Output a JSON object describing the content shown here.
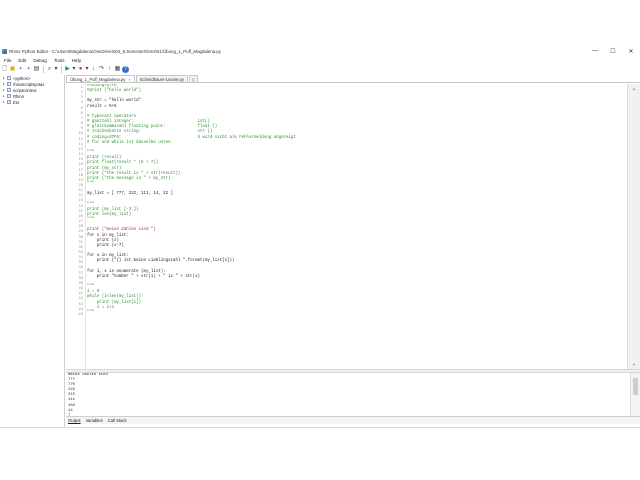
{
  "window": {
    "title": "Rhino Python Editor - C:\\Users\\Magdalena\\OneDrive\\003_5.Semester\\Dm2\\01\\Übung_1_Puff_Magdalena.py",
    "controls": [
      "—",
      "☐",
      "✕"
    ]
  },
  "menu": [
    "File",
    "Edit",
    "Debug",
    "Tools",
    "Help"
  ],
  "toolbar": {
    "icons": [
      "new-file-icon",
      "open-folder-icon",
      "save-icon",
      "save-all-icon",
      "print-icon",
      "find-icon",
      "dropdown-icon",
      "run-icon",
      "run-dropdown-icon",
      "stop-icon",
      "debug-dropdown-icon",
      "step-into-icon",
      "step-over-icon",
      "step-out-icon",
      "options-icon",
      "help-icon"
    ],
    "glyphs": {
      "new": "🗋",
      "open": "▣",
      "save": "▪",
      "save_all": "▪",
      "print": "▤",
      "find": "⌕",
      "find_dd": "▾",
      "run": "▶",
      "run_dd": "▾",
      "stop": "●",
      "stop_dd": "▾",
      "step_into": "↓",
      "step_over": "↷",
      "step_out": "↑",
      "options": "▦",
      "help": "?"
    }
  },
  "tree": [
    {
      "label": "<python>"
    },
    {
      "label": "rhinoscriptsyntax"
    },
    {
      "label": "scriptcontext"
    },
    {
      "label": "Rhino"
    },
    {
      "label": "Eto"
    }
  ],
  "tabs": [
    {
      "label": "Übung_1_Puff_Magdalena.py",
      "active": true,
      "close": "×"
    },
    {
      "label": "Schmidbauer-Leonie.py",
      "active": false,
      "close": ""
    }
  ],
  "new_tab_glyph": "▯",
  "code_lines": [
    {
      "n": "1",
      "t": "#coding=UTF8",
      "k": "c"
    },
    {
      "n": "2",
      "t": "#print (\"hello world\")",
      "k": "c"
    },
    {
      "n": "3",
      "t": "",
      "k": ""
    },
    {
      "n": "4",
      "t": "my_str = \"hello world\"",
      "k": ""
    },
    {
      "n": "5",
      "t": "result = 5+5",
      "k": ""
    },
    {
      "n": "6",
      "t": "",
      "k": ""
    },
    {
      "n": "7",
      "t": "# typecast operators",
      "k": "c"
    },
    {
      "n": "8",
      "t": "# ganzzahl integer:                          int()",
      "k": "c"
    },
    {
      "n": "9",
      "t": "# gleitkommazahl floating point:             float ()",
      "k": "c"
    },
    {
      "n": "10",
      "t": "# zeichenkette string:                       str ()",
      "k": "c"
    },
    {
      "n": "11",
      "t": "# coding=UTF8:                               ü wird nicht als Fehlermeldung angezeigt",
      "k": "c"
    },
    {
      "n": "12",
      "t": "# for und while ist dasselbe unten",
      "k": "c"
    },
    {
      "n": "13",
      "t": "",
      "k": ""
    },
    {
      "n": "14",
      "t": "\"\"\"",
      "k": "c"
    },
    {
      "n": "15",
      "t": "print (result)",
      "k": "c"
    },
    {
      "n": "16",
      "t": "print float(result * (5 + 7))",
      "k": "c"
    },
    {
      "n": "17",
      "t": "print (my_str)",
      "k": "c"
    },
    {
      "n": "18",
      "t": "print (\"the result is \" + str(result))",
      "k": "c"
    },
    {
      "n": "19",
      "t": "print (\"the message is \" + my_str)",
      "k": "c"
    },
    {
      "n": "20",
      "t": "\"\"\"",
      "k": "c"
    },
    {
      "n": "21",
      "t": "",
      "k": ""
    },
    {
      "n": "22",
      "t": "my_list = [ 777, 222, 111, 14, 22 ]",
      "k": ""
    },
    {
      "n": "23",
      "t": "",
      "k": ""
    },
    {
      "n": "24",
      "t": "\"\"\"",
      "k": "c"
    },
    {
      "n": "25",
      "t": "print (my_list [-3:])",
      "k": "c"
    },
    {
      "n": "26",
      "t": "print len(my_list)",
      "k": "c"
    },
    {
      "n": "27",
      "t": "\"\"\"",
      "k": "c"
    },
    {
      "n": "28",
      "t": "",
      "k": ""
    },
    {
      "n": "29",
      "t": "print (\"meine Zahlen sind \")",
      "k": "s"
    },
    {
      "n": "30",
      "t": "for x in my_list:",
      "k": ""
    },
    {
      "n": "31",
      "t": "    print (x)",
      "k": ""
    },
    {
      "n": "32",
      "t": "    print (x-7)",
      "k": ""
    },
    {
      "n": "33",
      "t": "",
      "k": ""
    },
    {
      "n": "34",
      "t": "for x in my_list:",
      "k": ""
    },
    {
      "n": "35",
      "t": "    print (\"{} ist meine Lieblingszahl \".format(my_list[1]))",
      "k": ""
    },
    {
      "n": "36",
      "t": "",
      "k": ""
    },
    {
      "n": "37",
      "t": "for i, x in enumerate (my_list):",
      "k": ""
    },
    {
      "n": "38",
      "t": "    print \"number \" + str(i) + \" is \" + str(x)",
      "k": ""
    },
    {
      "n": "39",
      "t": "",
      "k": ""
    },
    {
      "n": "40",
      "t": "\"\"\"",
      "k": "c"
    },
    {
      "n": "41",
      "t": "i = 0",
      "k": "c"
    },
    {
      "n": "42",
      "t": "while (i<len(my_list)):",
      "k": "c"
    },
    {
      "n": "43",
      "t": "    print (my_list[i])",
      "k": "c"
    },
    {
      "n": "44",
      "t": "    i = i+1",
      "k": "c"
    },
    {
      "n": "45",
      "t": "\"\"\"",
      "k": "c"
    }
  ],
  "output_lines": [
    "meine Zahlen sind",
    "777",
    "770",
    "222",
    "215",
    "111",
    "104",
    "14",
    "7",
    "22"
  ],
  "bottom_tabs": [
    {
      "label": "Output",
      "active": true
    },
    {
      "label": "Variables",
      "active": false
    },
    {
      "label": "Call Stack",
      "active": false
    }
  ],
  "colors": {
    "comment": "#2e8b2e",
    "string": "#a0323c",
    "run": "#1aa33a",
    "stop": "#d02b2b",
    "save": "#3a5fa8"
  }
}
